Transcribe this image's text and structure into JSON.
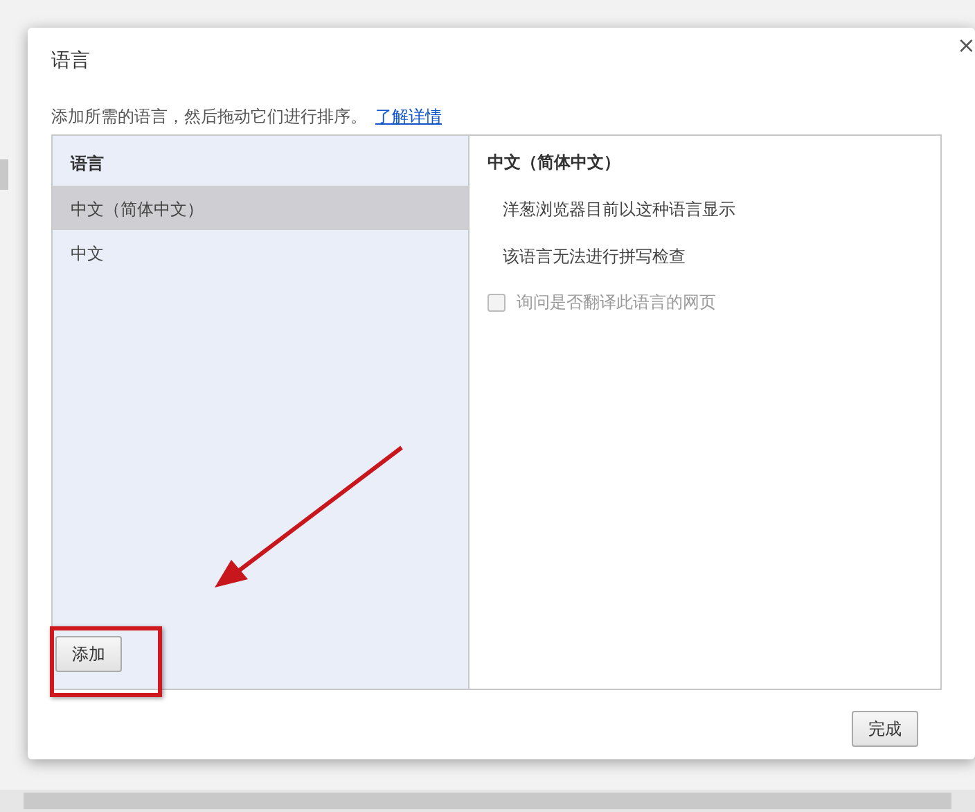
{
  "dialog": {
    "title": "语言",
    "close": "×",
    "description": "添加所需的语言，然后拖动它们进行排序。",
    "link": "了解详情"
  },
  "languages": {
    "heading": "语言",
    "items": [
      {
        "label": "中文（简体中文）",
        "selected": true
      },
      {
        "label": "中文",
        "selected": false
      }
    ],
    "add_button": "添加"
  },
  "details": {
    "title": "中文（简体中文）",
    "lines": [
      "洋葱浏览器目前以这种语言显示",
      "该语言无法进行拼写检查"
    ],
    "checkbox": {
      "label": "询问是否翻译此语言的网页",
      "checked": false,
      "disabled": true
    }
  },
  "done_button": "完成",
  "annotations": {
    "highlight_box": true,
    "arrow": true
  }
}
